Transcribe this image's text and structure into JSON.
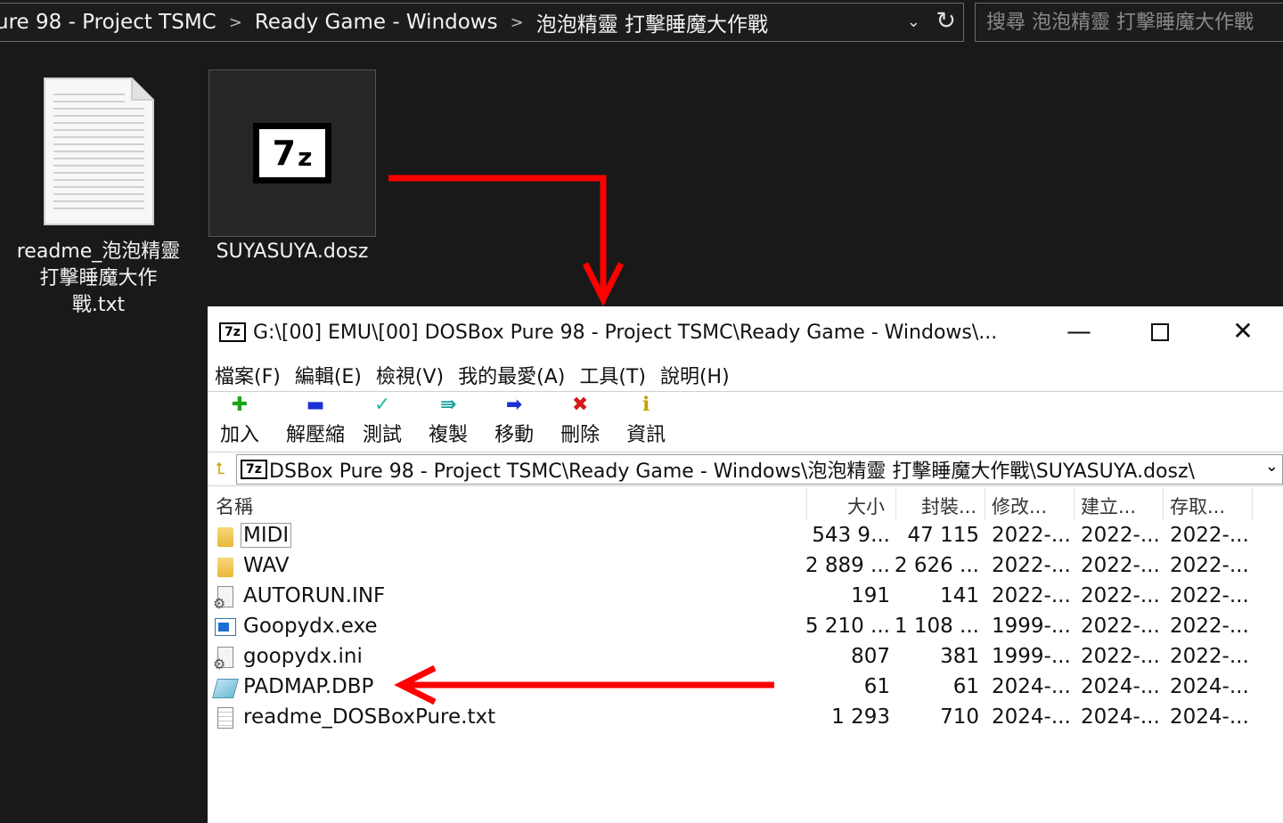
{
  "explorer": {
    "breadcrumbs": [
      "ure 98 - Project TSMC",
      "Ready Game - Windows",
      "泡泡精靈 打擊睡魔大作戰"
    ],
    "breadcrumb_separator": ">",
    "dropdown_glyph": "⌄",
    "refresh_glyph": "↻",
    "search_placeholder": "搜尋 泡泡精靈 打擊睡魔大作戰",
    "files": [
      {
        "label": "readme_泡泡精靈 打擊睡魔大作戰.txt",
        "icon": "text-file-icon"
      },
      {
        "label": "SUYASUYA.dosz",
        "icon": "7zip-archive-icon"
      }
    ]
  },
  "sevenzip": {
    "title": "G:\\[00] EMU\\[00] DOSBox Pure 98 - Project TSMC\\Ready Game - Windows\\...",
    "icon_text": "7z",
    "window_controls": {
      "minimize": "—",
      "maximize": "□",
      "close": "✕"
    },
    "menu": [
      "檔案(F)",
      "編輯(E)",
      "檢視(V)",
      "我的最愛(A)",
      "工具(T)",
      "說明(H)"
    ],
    "toolbar": [
      {
        "label": "加入",
        "icon": "plus-icon",
        "glyph": "✚",
        "color": "#1aa51a"
      },
      {
        "label": "解壓縮",
        "icon": "minus-icon",
        "glyph": "▬",
        "color": "#1a2fd6"
      },
      {
        "label": "測試",
        "icon": "check-icon",
        "glyph": "✓",
        "color": "#29b6b0"
      },
      {
        "label": "複製",
        "icon": "copy-arrow-icon",
        "glyph": "⇛",
        "color": "#16a0a0"
      },
      {
        "label": "移動",
        "icon": "move-arrow-icon",
        "glyph": "➡",
        "color": "#1a2fd6"
      },
      {
        "label": "刪除",
        "icon": "delete-x-icon",
        "glyph": "✖",
        "color": "#d21a1a"
      },
      {
        "label": "資訊",
        "icon": "info-icon",
        "glyph": "ℹ",
        "color": "#c9a100"
      }
    ],
    "path": "DSBox Pure 98 - Project TSMC\\Ready Game - Windows\\泡泡精靈 打擊睡魔大作戰\\SUYASUYA.dosz\\",
    "path_dropdown_glyph": "⌄",
    "up_glyph": "⮤",
    "columns": [
      "名稱",
      "大小",
      "封裝...",
      "修改...",
      "建立...",
      "存取..."
    ],
    "rows": [
      {
        "name": "MIDI",
        "size": "543 9...",
        "packed": "47 115",
        "modified": "2022-...",
        "created": "2022-...",
        "accessed": "2022-...",
        "icon": "folder-icon"
      },
      {
        "name": "WAV",
        "size": "2 889 ...",
        "packed": "2 626 ...",
        "modified": "2022-...",
        "created": "2022-...",
        "accessed": "2022-...",
        "icon": "folder-icon"
      },
      {
        "name": "AUTORUN.INF",
        "size": "191",
        "packed": "141",
        "modified": "2022-...",
        "created": "2022-...",
        "accessed": "2022-...",
        "icon": "config-file-icon"
      },
      {
        "name": "Goopydx.exe",
        "size": "5 210 ...",
        "packed": "1 108 ...",
        "modified": "1999-...",
        "created": "2022-...",
        "accessed": "2022-...",
        "icon": "exe-file-icon"
      },
      {
        "name": "goopydx.ini",
        "size": "807",
        "packed": "381",
        "modified": "1999-...",
        "created": "2022-...",
        "accessed": "2022-...",
        "icon": "config-file-icon"
      },
      {
        "name": "PADMAP.DBP",
        "size": "61",
        "packed": "61",
        "modified": "2024-...",
        "created": "2024-...",
        "accessed": "2024-...",
        "icon": "dbp-file-icon"
      },
      {
        "name": "readme_DOSBoxPure.txt",
        "size": "1 293",
        "packed": "710",
        "modified": "2024-...",
        "created": "2024-...",
        "accessed": "2024-...",
        "icon": "text-file-icon"
      }
    ]
  },
  "annotation_color": "#ff0000"
}
